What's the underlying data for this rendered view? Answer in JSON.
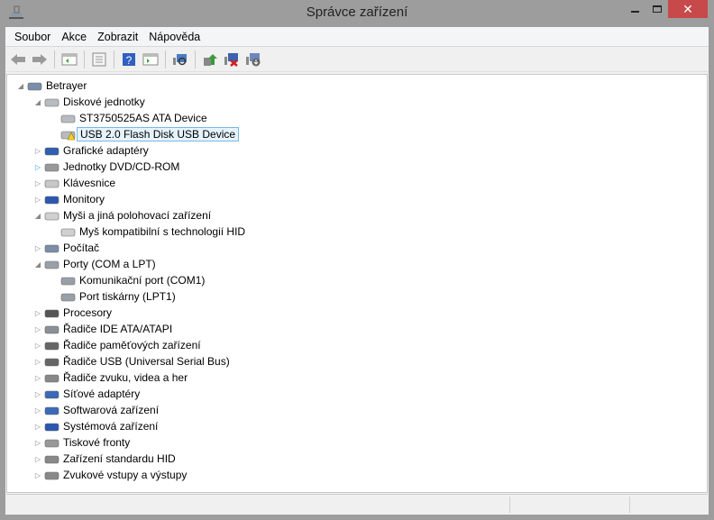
{
  "window": {
    "title": "Správce zařízení",
    "close_glyph": "✕"
  },
  "menu": [
    "Soubor",
    "Akce",
    "Zobrazit",
    "Nápověda"
  ],
  "toolbar": [
    "back-icon",
    "forward-icon",
    "show-hide-console-tree-icon",
    "properties-icon",
    "help-icon",
    "action-pane-icon",
    "scan-hardware-icon",
    "update-driver-icon",
    "uninstall-icon",
    "disable-icon"
  ],
  "tree": [
    {
      "level": 0,
      "toggle": "open",
      "label": "Betrayer",
      "icon": "computer-icon"
    },
    {
      "level": 1,
      "toggle": "open",
      "label": "Diskové jednotky",
      "icon": "disk-icon"
    },
    {
      "level": 2,
      "toggle": "none",
      "label": "ST3750525AS ATA Device",
      "icon": "disk-icon"
    },
    {
      "level": 2,
      "toggle": "none",
      "label": "USB 2.0 Flash Disk USB Device",
      "icon": "disk-warning-icon",
      "selected": true
    },
    {
      "level": 1,
      "toggle": "closed",
      "label": "Grafické adaptéry",
      "icon": "display-adapter-icon"
    },
    {
      "level": 1,
      "toggle": "closed-blue",
      "label": "Jednotky DVD/CD-ROM",
      "icon": "dvd-icon"
    },
    {
      "level": 1,
      "toggle": "closed",
      "label": "Klávesnice",
      "icon": "keyboard-icon"
    },
    {
      "level": 1,
      "toggle": "closed",
      "label": "Monitory",
      "icon": "monitor-icon"
    },
    {
      "level": 1,
      "toggle": "open",
      "label": "Myši a jiná polohovací zařízení",
      "icon": "mouse-icon"
    },
    {
      "level": 2,
      "toggle": "none",
      "label": "Myš kompatibilní s technologií HID",
      "icon": "mouse-icon"
    },
    {
      "level": 1,
      "toggle": "closed",
      "label": "Počítač",
      "icon": "computer-icon"
    },
    {
      "level": 1,
      "toggle": "open",
      "label": "Porty (COM a LPT)",
      "icon": "port-icon"
    },
    {
      "level": 2,
      "toggle": "none",
      "label": "Komunikační port (COM1)",
      "icon": "port-icon"
    },
    {
      "level": 2,
      "toggle": "none",
      "label": "Port tiskárny (LPT1)",
      "icon": "port-icon"
    },
    {
      "level": 1,
      "toggle": "closed",
      "label": "Procesory",
      "icon": "processor-icon"
    },
    {
      "level": 1,
      "toggle": "closed",
      "label": "Řadiče IDE ATA/ATAPI",
      "icon": "ide-icon"
    },
    {
      "level": 1,
      "toggle": "closed",
      "label": "Řadiče paměťových zařízení",
      "icon": "storage-controller-icon"
    },
    {
      "level": 1,
      "toggle": "closed",
      "label": "Řadiče USB (Universal Serial Bus)",
      "icon": "usb-icon"
    },
    {
      "level": 1,
      "toggle": "closed",
      "label": "Řadiče zvuku, videa a her",
      "icon": "sound-icon"
    },
    {
      "level": 1,
      "toggle": "closed",
      "label": "Síťové adaptéry",
      "icon": "network-icon"
    },
    {
      "level": 1,
      "toggle": "closed",
      "label": "Softwarová zařízení",
      "icon": "software-device-icon"
    },
    {
      "level": 1,
      "toggle": "closed",
      "label": "Systémová zařízení",
      "icon": "system-device-icon"
    },
    {
      "level": 1,
      "toggle": "closed",
      "label": "Tiskové fronty",
      "icon": "printer-icon"
    },
    {
      "level": 1,
      "toggle": "closed",
      "label": "Zařízení standardu HID",
      "icon": "hid-icon"
    },
    {
      "level": 1,
      "toggle": "closed",
      "label": "Zvukové vstupy a výstupy",
      "icon": "speaker-icon"
    }
  ],
  "colors": {
    "close": "#c7494a",
    "selection": "#e5f3fb",
    "selection_border": "#7ab8e0"
  }
}
